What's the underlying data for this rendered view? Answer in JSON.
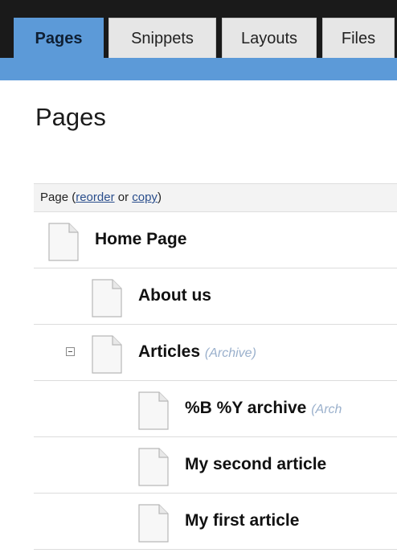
{
  "tabs": [
    {
      "label": "Pages",
      "active": true
    },
    {
      "label": "Snippets",
      "active": false
    },
    {
      "label": "Layouts",
      "active": false
    },
    {
      "label": "Files",
      "active": false
    }
  ],
  "page_title": "Pages",
  "table_header": {
    "prefix": "Page (",
    "reorder_link": "reorder",
    "or_text": " or ",
    "copy_link": "copy",
    "suffix": ")"
  },
  "rows": [
    {
      "name": "Home Page",
      "tag": "",
      "level": 0,
      "toggle": false
    },
    {
      "name": "About us",
      "tag": "",
      "level": 1,
      "toggle": false
    },
    {
      "name": "Articles",
      "tag": "(Archive)",
      "level": 1,
      "toggle": "collapse"
    },
    {
      "name": "%B %Y archive",
      "tag": "(Arch",
      "level": 2,
      "toggle": false
    },
    {
      "name": "My second article",
      "tag": "",
      "level": 2,
      "toggle": false
    },
    {
      "name": "My first article",
      "tag": "",
      "level": 2,
      "toggle": false
    }
  ],
  "colors": {
    "active_tab": "#5c9ad8",
    "top_bar": "#1a1a1a",
    "link": "#2a4e8c",
    "archive_tag": "#9ab0cc"
  },
  "icons": {
    "page": "page-icon",
    "collapse": "collapse-icon"
  }
}
